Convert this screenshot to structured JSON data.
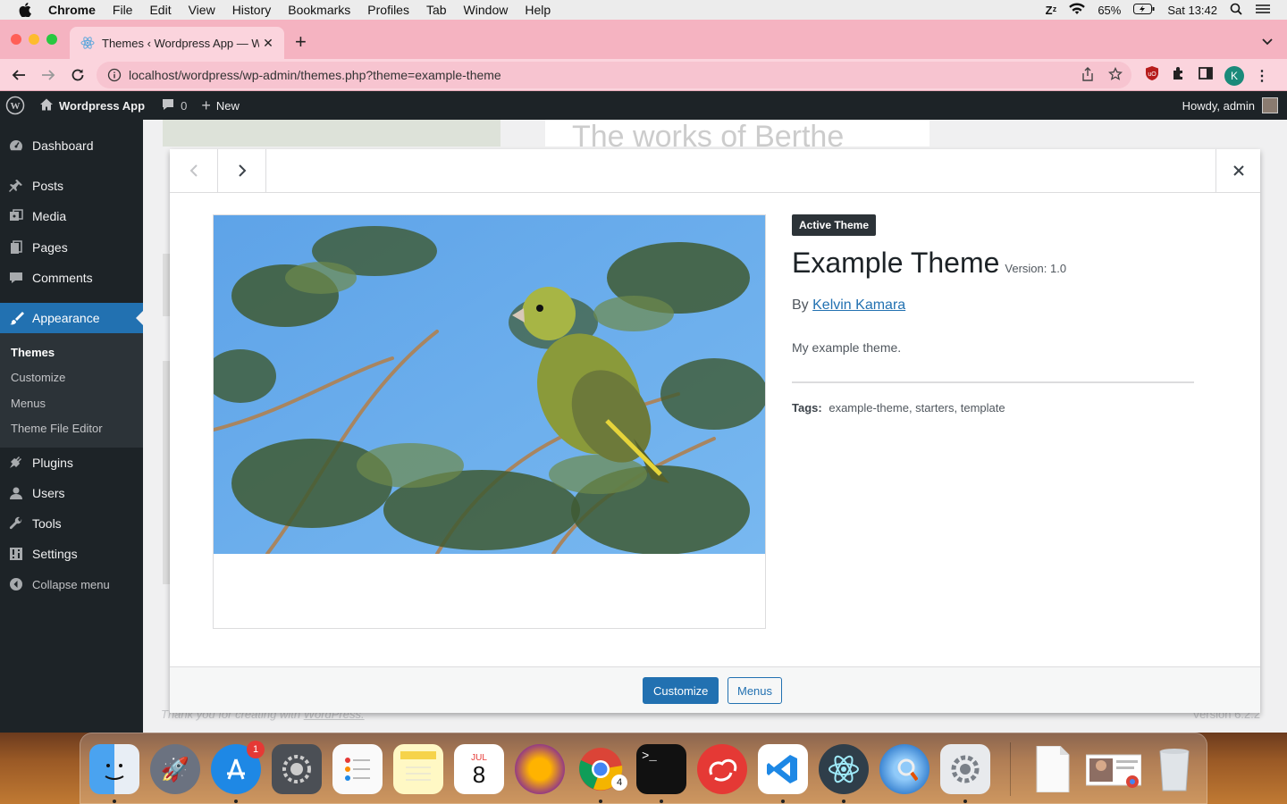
{
  "mac_menubar": {
    "app_name": "Chrome",
    "menus": [
      "File",
      "Edit",
      "View",
      "History",
      "Bookmarks",
      "Profiles",
      "Tab",
      "Window",
      "Help"
    ],
    "battery": "65%",
    "clock": "Sat 13:42"
  },
  "browser": {
    "tab_title": "Themes ‹ Wordpress App — W",
    "url": "localhost/wordpress/wp-admin/themes.php?theme=example-theme",
    "profile_initial": "K"
  },
  "adminbar": {
    "site_name": "Wordpress App",
    "comments_count": "0",
    "new_label": "New",
    "howdy": "Howdy, admin"
  },
  "sidebar": {
    "items": [
      {
        "label": "Dashboard",
        "icon": "dashboard-icon"
      },
      {
        "label": "Posts",
        "icon": "pin-icon"
      },
      {
        "label": "Media",
        "icon": "media-icon"
      },
      {
        "label": "Pages",
        "icon": "pages-icon"
      },
      {
        "label": "Comments",
        "icon": "comment-icon"
      },
      {
        "label": "Appearance",
        "icon": "brush-icon"
      },
      {
        "label": "Plugins",
        "icon": "plug-icon"
      },
      {
        "label": "Users",
        "icon": "user-icon"
      },
      {
        "label": "Tools",
        "icon": "wrench-icon"
      },
      {
        "label": "Settings",
        "icon": "settings-icon"
      },
      {
        "label": "Collapse menu",
        "icon": "collapse-icon"
      }
    ],
    "submenu": [
      "Themes",
      "Customize",
      "Menus",
      "Theme File Editor"
    ]
  },
  "background": {
    "heading": "The works of Berthe",
    "footer_prefix": "Thank you for creating with ",
    "footer_link": "WordPress.",
    "version": "Version 6.2.2"
  },
  "theme": {
    "badge": "Active Theme",
    "name": "Example Theme",
    "version": "Version: 1.0",
    "author_prefix": "By",
    "author": "Kelvin Kamara",
    "description": "My example theme.",
    "tags_label": "Tags:",
    "tags": "example-theme, starters, template"
  },
  "footer_buttons": {
    "customize": "Customize",
    "menus": "Menus"
  },
  "dock": {
    "app_store_badge": "1",
    "chrome_badge": "4",
    "calendar_month": "JUL",
    "calendar_day": "8"
  },
  "colors": {
    "wp_blue": "#2271b1",
    "wp_dark": "#1d2327",
    "tab_pink": "#f5b3c1"
  }
}
